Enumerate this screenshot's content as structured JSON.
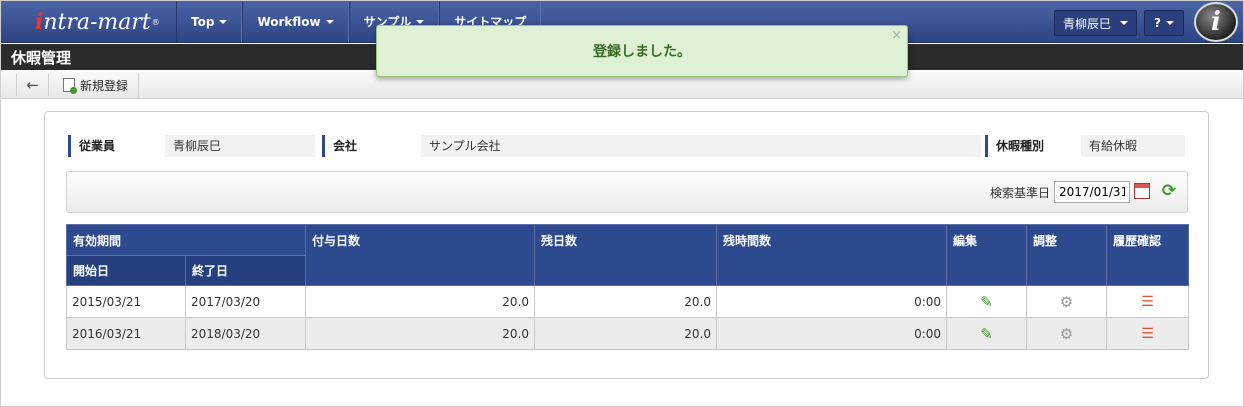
{
  "header": {
    "logo_i": "i",
    "logo_text": "ntra-mart",
    "logo_mark": "®",
    "nav": [
      {
        "label": "Top"
      },
      {
        "label": "Workflow"
      },
      {
        "label": "サンプル"
      },
      {
        "label": "サイトマップ"
      }
    ],
    "user_label": "青柳辰巳",
    "help_label": "?",
    "brand_icon": "i"
  },
  "page": {
    "title": "休暇管理"
  },
  "toolbar": {
    "back_icon": "←",
    "new_label": "新規登録"
  },
  "info": {
    "employee_label": "従業員",
    "employee_value": "青柳辰巳",
    "company_label": "会社",
    "company_value": "サンプル会社",
    "leave_type_label": "休暇種別",
    "leave_type_value": "有給休暇"
  },
  "search": {
    "date_label": "検索基準日",
    "date_value": "2017/01/31"
  },
  "table": {
    "headers": {
      "valid_period": "有効期間",
      "start": "開始日",
      "end": "終了日",
      "granted_days": "付与日数",
      "remaining_days": "残日数",
      "remaining_hours": "残時間数",
      "edit": "編集",
      "adjust": "調整",
      "history": "履歴確認"
    },
    "rows": [
      {
        "start": "2015/03/21",
        "end": "2017/03/20",
        "granted": "20.0",
        "remaining": "20.0",
        "hours": "0:00"
      },
      {
        "start": "2016/03/21",
        "end": "2018/03/20",
        "granted": "20.0",
        "remaining": "20.0",
        "hours": "0:00"
      }
    ],
    "edit_icon": "pencil-icon",
    "adjust_icon": "gear-icon",
    "history_icon": "list-icon"
  },
  "toast": {
    "message": "登録しました。",
    "close": "×"
  },
  "colors": {
    "nav_bg": "#3a539a",
    "table_header": "#2d4a8f",
    "toast_bg": "#dff1d5",
    "toast_text": "#3a6b22",
    "accent_green": "#3c9a2a",
    "list_icon": "#e0502d"
  }
}
